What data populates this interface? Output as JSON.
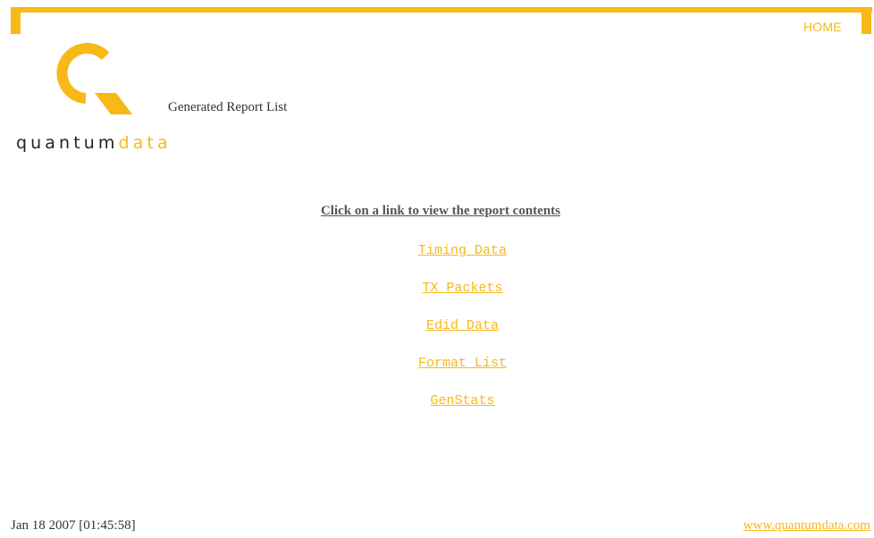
{
  "header": {
    "home_label": "HOME"
  },
  "logo": {
    "word_part1": "quantum",
    "word_part2": "data"
  },
  "page": {
    "title": "Generated Report List",
    "instructions": "Click on a link to view the report contents"
  },
  "reports": [
    {
      "label": "Timing Data"
    },
    {
      "label": "TX Packets"
    },
    {
      "label": "Edid Data"
    },
    {
      "label": "Format List"
    },
    {
      "label": "GenStats"
    }
  ],
  "footer": {
    "timestamp": "Jan 18 2007 [01:45:58]",
    "site_link": "www.quantumdata.com"
  },
  "colors": {
    "accent": "#f7b818",
    "text": "#333333",
    "instructions": "#555555"
  }
}
